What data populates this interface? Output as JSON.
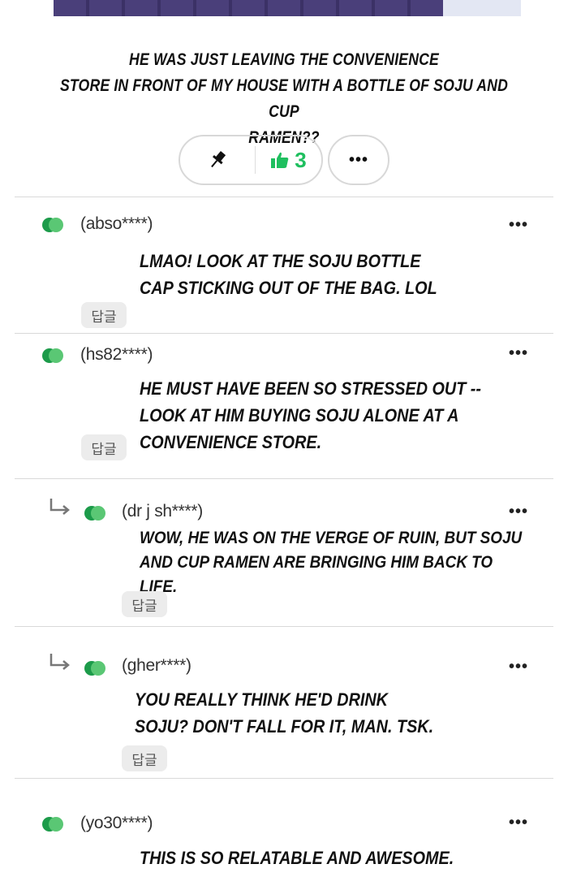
{
  "post": {
    "text": "HE WAS JUST LEAVING THE CONVENIENCE\nSTORE IN FRONT OF MY HOUSE WITH A BOTTLE OF SOJU AND CUP\nRAMEN??",
    "like_count": "3",
    "more_label": "•••"
  },
  "colors": {
    "accent_green": "#1fbf5f",
    "reply_bg": "#ececec",
    "divider": "#d9d9d9"
  },
  "icons": {
    "pin": "pin-icon",
    "thumbs_up": "thumbs-up-icon",
    "author": "green-dots-icon",
    "reply_indent": "reply-arrow-icon"
  },
  "comments": [
    {
      "author": "(abso****)",
      "body": "LMAO! LOOK AT THE SOJU BOTTLE\nCAP STICKING OUT OF THE BAG. LOL",
      "reply_label": "답글",
      "more": "•••"
    },
    {
      "author": "(hs82****)",
      "body": "HE MUST HAVE BEEN SO STRESSED OUT --\nLOOK AT HIM BUYING SOJU ALONE AT A\nCONVENIENCE STORE.",
      "reply_label": "답글",
      "more": "•••"
    },
    {
      "author": "(dr j sh****)",
      "body": "WOW, HE WAS ON THE VERGE OF RUIN, BUT SOJU\nAND CUP RAMEN ARE BRINGING HIM BACK TO LIFE.",
      "reply_label": "답글",
      "more": "•••"
    },
    {
      "author": "(gher****)",
      "body": "YOU REALLY THINK HE'D DRINK\nSOJU? DON'T FALL FOR IT, MAN. TSK.",
      "reply_label": "답글",
      "more": "•••"
    },
    {
      "author": "(yo30****)",
      "body": "THIS IS SO RELATABLE AND AWESOME.",
      "more": "•••"
    }
  ]
}
